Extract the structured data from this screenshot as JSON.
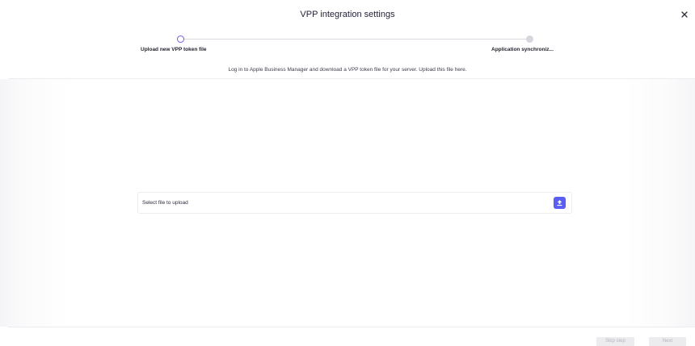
{
  "dialog": {
    "title": "VPP integration settings",
    "close_icon": "close-icon"
  },
  "stepper": {
    "steps": [
      {
        "label": "Upload new VPP token file",
        "state": "active"
      },
      {
        "label": "Application synchroniz...",
        "state": "inactive"
      }
    ],
    "accent_color": "#6a5cf0"
  },
  "instruction": "Log in to Apple Business Manager and download a VPP token file for your server. Upload this file here.",
  "upload": {
    "placeholder": "Select file to upload",
    "button_icon": "upload-icon",
    "button_color": "#5b5ef2"
  },
  "footer": {
    "skip_label": "Skip step",
    "next_label": "Next"
  }
}
